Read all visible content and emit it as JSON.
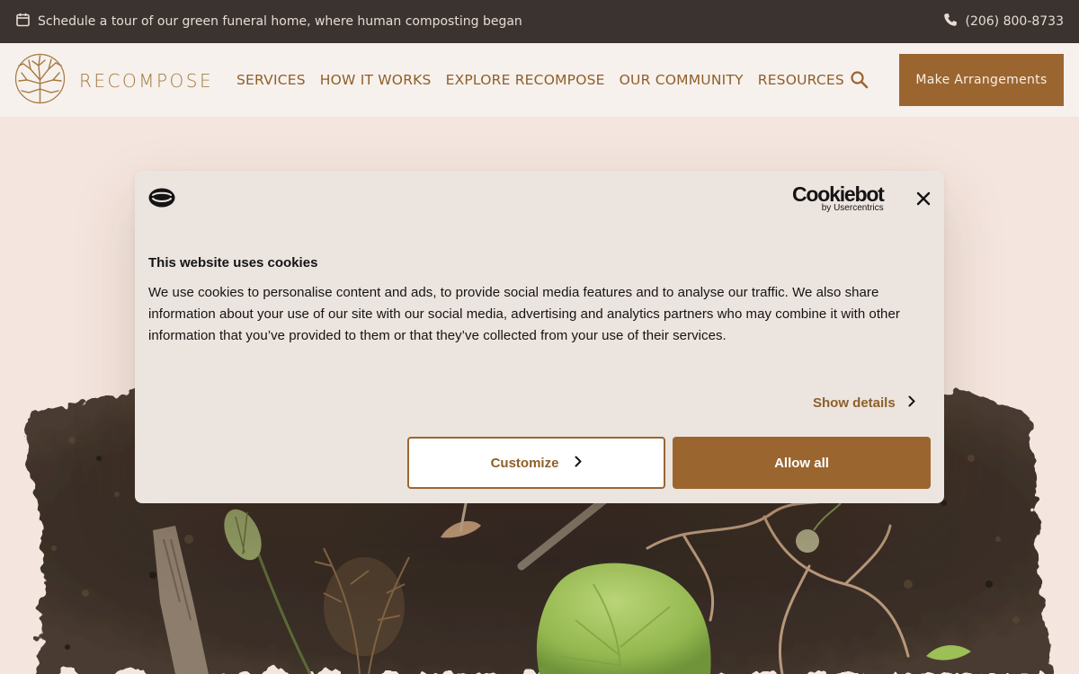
{
  "topbar": {
    "tour_text": "Schedule a tour of our green funeral home, where human composting began",
    "phone": "(206) 800-8733",
    "calendar_icon": "calendar-icon",
    "phone_icon": "phone-icon"
  },
  "header": {
    "logo_text": "RECOMPOSE",
    "nav": [
      "SERVICES",
      "HOW IT WORKS",
      "EXPLORE RECOMPOSE",
      "OUR COMMUNITY",
      "RESOURCES"
    ],
    "search_icon": "search-icon",
    "cta_label": "Make Arrangements"
  },
  "cookie_dialog": {
    "brand_name": "Cookiebot",
    "brand_by": "by Usercentrics",
    "title": "This website uses cookies",
    "body": "We use cookies to personalise content and ads, to provide social media features and to analyse our traffic. We also share information about your use of our site with our social media, advertising and analytics partners who may combine it with other information that you’ve provided to them or that they’ve collected from your use of their services.",
    "show_details_label": "Show details",
    "customize_label": "Customize",
    "allow_all_label": "Allow all"
  },
  "colors": {
    "brand_brown": "#9b6530",
    "nav_text": "#8f5f2a",
    "topbar_bg": "#3a3330",
    "hero_bg": "#f4e5de",
    "dialog_bg": "#ece4df"
  }
}
